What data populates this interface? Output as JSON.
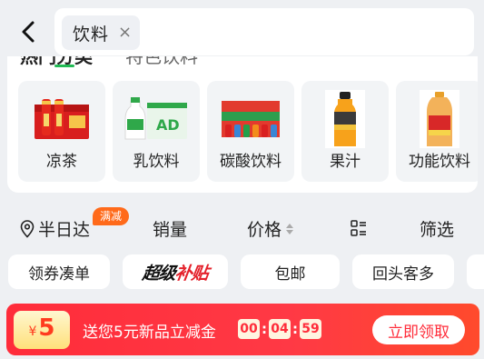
{
  "search": {
    "chip_label": "饮料",
    "chip_close": "×"
  },
  "category": {
    "tabs": [
      "热门分类",
      "特色饮料"
    ],
    "items": [
      {
        "label": "凉茶",
        "icon": "herbal-tea-icon"
      },
      {
        "label": "乳饮料",
        "icon": "milk-drink-icon"
      },
      {
        "label": "碳酸饮料",
        "icon": "soda-icon"
      },
      {
        "label": "果汁",
        "icon": "juice-icon"
      },
      {
        "label": "功能饮料",
        "icon": "energy-drink-icon"
      }
    ]
  },
  "sort": {
    "delivery": "半日达",
    "delivery_badge": "满减",
    "sales": "销量",
    "price": "价格",
    "filter": "筛选"
  },
  "filters": {
    "coupon": "领券凑单",
    "super_subsidy_black": "超级",
    "super_subsidy_red": "补贴",
    "free_shipping": "包邮",
    "repeat_customers": "回头客多"
  },
  "coupon": {
    "currency": "¥",
    "amount": "5",
    "text": "送您5元新品立减金",
    "timer": [
      "00",
      "04",
      "59"
    ],
    "button": "立即领取"
  },
  "colors": {
    "accent_green": "#22bb55",
    "badge_orange": "#ff6a1a",
    "coupon_red": "#ff2c3a",
    "page_bg": "#eef0f3"
  }
}
